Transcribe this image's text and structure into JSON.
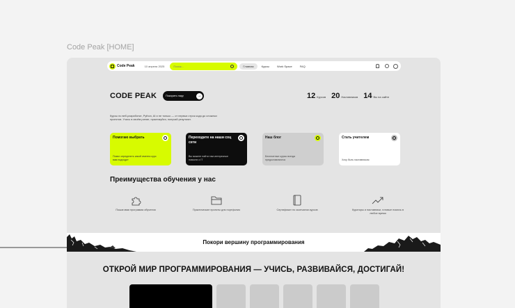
{
  "frame_label": "Code Peak [HOME]",
  "header": {
    "logo_text": "Code Peak",
    "date": "10 апреля 2025",
    "search_placeholder": "Поиск...",
    "nav": [
      "Главная",
      "Курсы",
      "Work Space",
      "FAQ"
    ],
    "nav_active_index": 0,
    "icons": [
      "bell-icon",
      "globe-icon",
      "user-icon"
    ]
  },
  "hero": {
    "title": "CODE PEAK",
    "button_label": "Покорить пару",
    "stats": [
      {
        "num": "12",
        "label": "Курсов"
      },
      {
        "num": "20",
        "label": "Наставников"
      },
      {
        "num": "14",
        "label": "Вы на сайте"
      }
    ],
    "description": "Курсы по веб-разработке, Python, AI и не только — от первых строк кода до сложных проектов. Учись в своём ритме, практикуйся, получай результат."
  },
  "cards": [
    {
      "title": "Помогаю выбрать",
      "text": "Помог определить какой именно курс вам подходит"
    },
    {
      "title": "Переходите на наши соц сети",
      "text": "Вы можете найти там интересные новости о IT"
    },
    {
      "title": "Наш блог",
      "text": "Бесплатные курсы всегда предоставляются"
    },
    {
      "title": "Стать учителем",
      "text": "Хочу быть наставником"
    }
  ],
  "advantages": {
    "title": "Преимущества обучения у нас",
    "items": [
      {
        "icon": "puzzle-icon",
        "label": "Пошаговая программа обучения"
      },
      {
        "icon": "folder-icon",
        "label": "Практические проекты для портфолио"
      },
      {
        "icon": "book-icon",
        "label": "Сертификат по окончании курсов"
      },
      {
        "icon": "trend-up-icon",
        "label": "Кураторы и наставники, готовые помочь в любое время"
      }
    ]
  },
  "banner": {
    "text": "Покори вершину программирования"
  },
  "bottom": {
    "title": "ОТКРОЙ МИР ПРОГРАММИРОВАНИЯ — УЧИСЬ, РАЗВИВАЙСЯ, ДОСТИГАЙ!"
  },
  "colors": {
    "accent": "#d7fb00",
    "dark": "#0d0d0d",
    "background": "#e4e4e4"
  }
}
